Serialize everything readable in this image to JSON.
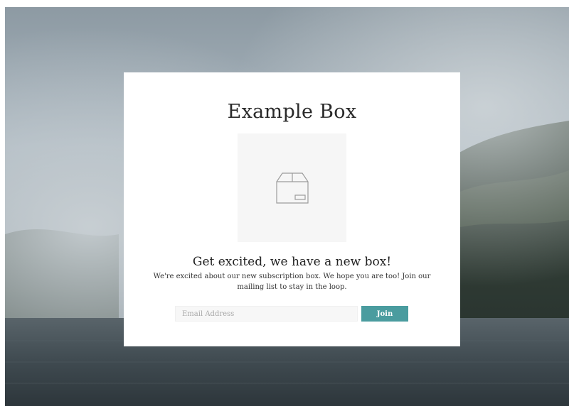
{
  "popup": {
    "title": "Example Box",
    "image_icon": "box-icon",
    "heading": "Get excited, we have a new box!",
    "body": "We're excited about our new subscription box. We hope you are too! Join our mailing list to stay in the loop.",
    "email_placeholder": "Email Address",
    "email_value": "",
    "join_label": "Join"
  },
  "colors": {
    "accent": "#4a9c9f",
    "modal_background": "#ffffff",
    "input_background": "#f7f7f7",
    "image_background": "#f6f6f6"
  }
}
